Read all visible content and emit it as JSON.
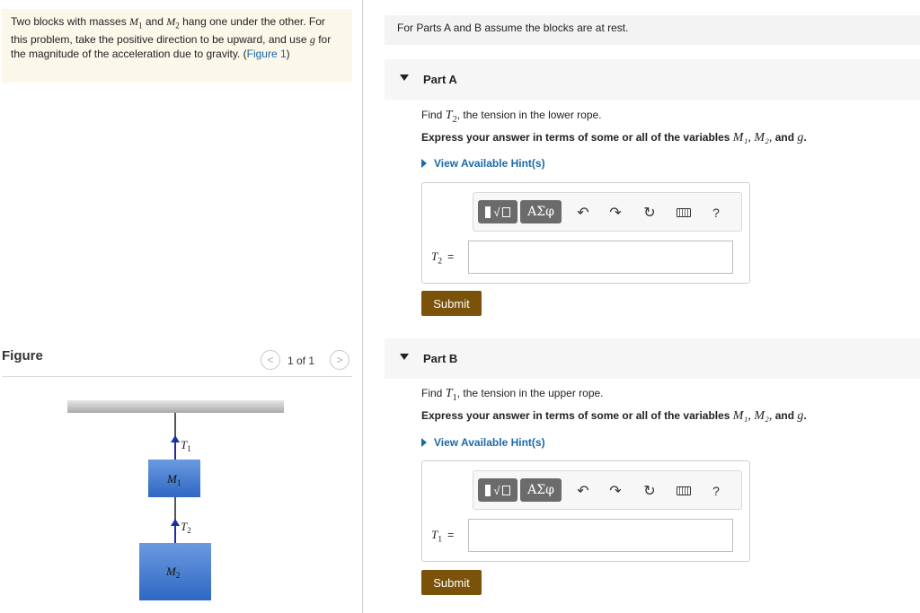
{
  "intro": {
    "t1": "Two blocks with masses ",
    "m1": "M",
    "m1_sub": "1",
    "t2": " and ",
    "m2": "M",
    "m2_sub": "2",
    "t3": " hang one under the other. For this problem, take the positive direction to be upward, and use ",
    "g": "g",
    "t4": " for the magnitude of the acceleration due to gravity. (",
    "figure_link": "Figure 1",
    "t5": ")"
  },
  "figure": {
    "title": "Figure",
    "count": "1 of 1",
    "prev_icon": "chevron-left-icon",
    "next_icon": "chevron-right-icon",
    "labels": {
      "t1": "T",
      "t1_sub": "1",
      "t2": "T",
      "t2_sub": "2",
      "m1": "M",
      "m1_sub": "1",
      "m2": "M",
      "m2_sub": "2"
    },
    "colors": {
      "ceiling": "#c9c9c9",
      "block": "#4a7fd0",
      "arrow": "#1a2fa0"
    }
  },
  "banner": "For Parts A and B assume the blocks are at rest.",
  "parts": [
    {
      "label": "Part A",
      "q_pre": "Find ",
      "q_var": "T",
      "q_sub": "2",
      "q_post": ", the tension in the lower rope.",
      "express_pre": "Express your answer in terms of some or all of the variables ",
      "express_vars": "M₁, M₂,",
      "express_and": " and ",
      "express_g": "g",
      "express_end": ".",
      "hint": "View Available Hint(s)",
      "var_label": "T",
      "var_sub": "2",
      "eq": "=",
      "submit": "Submit"
    },
    {
      "label": "Part B",
      "q_pre": "Find ",
      "q_var": "T",
      "q_sub": "1",
      "q_post": ", the tension in the upper rope.",
      "express_pre": "Express your answer in terms of some or all of the variables ",
      "express_vars": "M₁, M₂,",
      "express_and": " and ",
      "express_g": "g",
      "express_end": ".",
      "hint": "View Available Hint(s)",
      "var_label": "T",
      "var_sub": "1",
      "eq": "=",
      "submit": "Submit"
    }
  ],
  "toolbar": {
    "greek": "ΑΣφ",
    "help": "?",
    "undo": "↶",
    "redo": "↷",
    "reset": "↻",
    "icons": [
      "template-icon",
      "greek-symbols-icon",
      "undo-icon",
      "redo-icon",
      "reset-icon",
      "keyboard-icon",
      "help-icon"
    ]
  }
}
